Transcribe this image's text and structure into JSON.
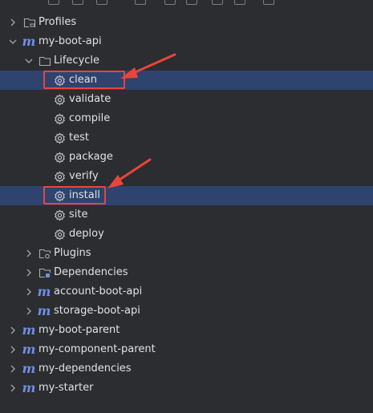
{
  "tree": {
    "profiles": "Profiles",
    "project": "my-boot-api",
    "lifecycle": "Lifecycle",
    "goals": [
      "clean",
      "validate",
      "compile",
      "test",
      "package",
      "verify",
      "install",
      "site",
      "deploy"
    ],
    "plugins": "Plugins",
    "dependencies": "Dependencies",
    "modules": [
      "account-boot-api",
      "storage-boot-api"
    ],
    "root_projects": [
      "my-boot-parent",
      "my-component-parent",
      "my-dependencies",
      "my-starter"
    ]
  },
  "selected_goals": [
    "clean",
    "install"
  ],
  "colors": {
    "background": "#2b2d30",
    "selection": "#2e436e",
    "annotation": "#e8453c",
    "maven_icon": "#6f8ee8"
  }
}
